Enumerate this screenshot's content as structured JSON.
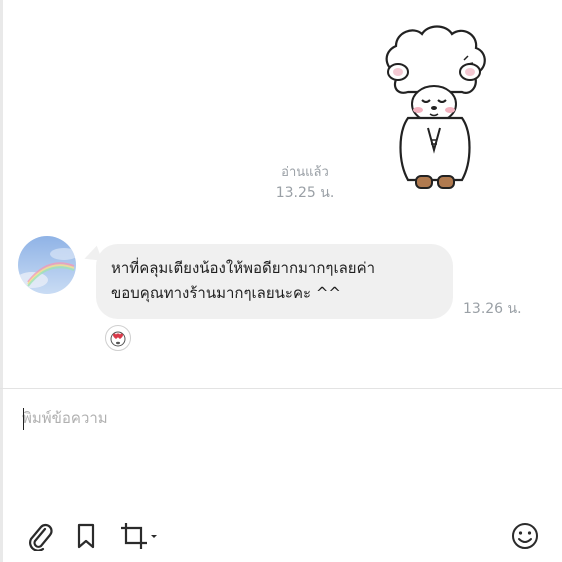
{
  "chat": {
    "read_receipt": {
      "status": "อ่านแล้ว",
      "time": "13.25 น."
    },
    "incoming_message": {
      "lines": [
        "หาที่คลุมเตียงน้องให้พอดียากมากๆเลยค่า",
        "ขอบคุณทางร้านมากๆเลยนะคะ ^^"
      ],
      "time": "13.26 น."
    }
  },
  "composer": {
    "placeholder": "พิมพ์ข้อความ",
    "value": ""
  },
  "toolbar": {
    "icons": [
      "paperclip-icon",
      "bookmark-icon",
      "crop-icon",
      "chevron-down-icon",
      "smiley-icon"
    ]
  },
  "colors": {
    "bubble": "#f0f0f0",
    "meta_text": "#9aa0a6",
    "divider": "#e3e3e3",
    "icon": "#2b2b2b"
  }
}
